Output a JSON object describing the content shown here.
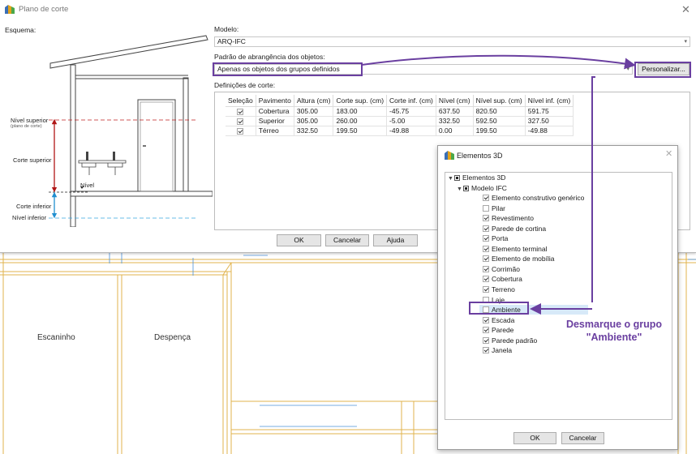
{
  "window": {
    "title": "Plano de corte",
    "close_glyph": "✕"
  },
  "schematic": {
    "label": "Esquema:",
    "annotations": {
      "nivel_superior": "Nível superior",
      "plano_de_corte": "(plano de corte)",
      "corte_superior": "Corte superior",
      "nivel": "Nível",
      "corte_inferior": "Corte inferior",
      "nivel_inferior": "Nível inferior"
    }
  },
  "model": {
    "label": "Modelo:",
    "value": "ARQ-IFC"
  },
  "scope": {
    "label": "Padrão de abrangência dos objetos:",
    "value": "Apenas os objetos dos grupos definidos",
    "customize_button": "Personalizar..."
  },
  "cuts": {
    "label": "Definições de corte:",
    "columns": [
      "Seleção",
      "Pavimento",
      "Altura (cm)",
      "Corte sup. (cm)",
      "Corte inf. (cm)",
      "Nível (cm)",
      "Nível sup. (cm)",
      "Nível inf. (cm)"
    ],
    "rows": [
      {
        "selected": true,
        "pavimento": "Cobertura",
        "altura": "305.00",
        "corte_sup": "183.00",
        "corte_inf": "-45.75",
        "nivel": "637.50",
        "nivel_sup": "820.50",
        "nivel_inf": "591.75"
      },
      {
        "selected": true,
        "pavimento": "Superior",
        "altura": "305.00",
        "corte_sup": "260.00",
        "corte_inf": "-5.00",
        "nivel": "332.50",
        "nivel_sup": "592.50",
        "nivel_inf": "327.50"
      },
      {
        "selected": true,
        "pavimento": "Térreo",
        "altura": "332.50",
        "corte_sup": "199.50",
        "corte_inf": "-49.88",
        "nivel": "0.00",
        "nivel_sup": "199.50",
        "nivel_inf": "-49.88"
      }
    ]
  },
  "buttons": {
    "ok": "OK",
    "cancel": "Cancelar",
    "help": "Ajuda"
  },
  "plan": {
    "rooms": [
      "Escaninho",
      "Despença"
    ]
  },
  "elements_dialog": {
    "title": "Elementos 3D",
    "close_glyph": "✕",
    "root": "Elementos 3D",
    "model": "Modelo IFC",
    "items": [
      {
        "label": "Elemento construtivo genérico",
        "checked": true
      },
      {
        "label": "Pilar",
        "checked": false
      },
      {
        "label": "Revestimento",
        "checked": true
      },
      {
        "label": "Parede de cortina",
        "checked": true
      },
      {
        "label": "Porta",
        "checked": true
      },
      {
        "label": "Elemento terminal",
        "checked": true
      },
      {
        "label": "Elemento de mobília",
        "checked": true
      },
      {
        "label": "Corrimão",
        "checked": true
      },
      {
        "label": "Cobertura",
        "checked": true
      },
      {
        "label": "Terreno",
        "checked": true
      },
      {
        "label": "Laje",
        "checked": false
      },
      {
        "label": "Ambiente",
        "checked": false
      },
      {
        "label": "Escada",
        "checked": true
      },
      {
        "label": "Parede",
        "checked": true
      },
      {
        "label": "Parede padrão",
        "checked": true
      },
      {
        "label": "Janela",
        "checked": true
      }
    ],
    "ok": "OK",
    "cancel": "Cancelar"
  },
  "callout": {
    "line1": "Desmarque o grupo",
    "line2": "\"Ambiente\""
  },
  "colors": {
    "highlight": "#6a3fa0",
    "selected_row": "#d7e9f8",
    "plan_lines": "#e0b34c"
  }
}
